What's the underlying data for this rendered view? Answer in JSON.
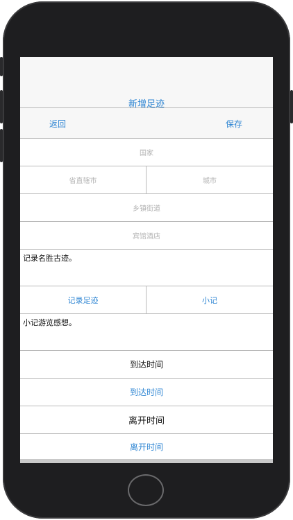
{
  "nav": {
    "title": "新增足迹",
    "back_label": "返回",
    "save_label": "保存"
  },
  "form": {
    "country_placeholder": "国家",
    "province_placeholder": "省直辖市",
    "city_placeholder": "城市",
    "street_placeholder": "乡镇街道",
    "hotel_placeholder": "宾馆酒店",
    "sights_text": "记录名胜古迹。",
    "tab_record_label": "记录足迹",
    "tab_notes_label": "小记",
    "notes_text": "小记游览感想。",
    "arrival_label": "到达时间",
    "arrival_button": "到达时间",
    "departure_label": "离开时间",
    "departure_button": "离开时间"
  },
  "colors": {
    "accent": "#2f86d3",
    "placeholder": "#b3b3b3",
    "border": "#b8b8b8",
    "nav_bg": "#f7f7f7"
  }
}
